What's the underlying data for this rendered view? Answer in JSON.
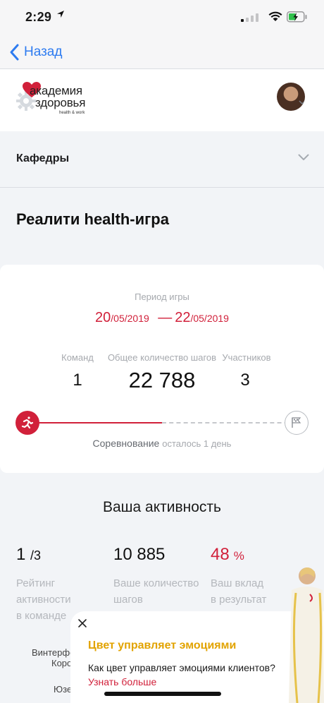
{
  "status_bar": {
    "time": "2:29"
  },
  "nav": {
    "back_label": "Назад"
  },
  "brand": {
    "line1": "академия",
    "line2": "здоровья",
    "tagline": "health & work"
  },
  "departments": {
    "label": "Кафедры"
  },
  "page_title": "Реалити health-игра",
  "game": {
    "period_label": "Период игры",
    "start_day_month": "20",
    "start_rest": "/05/2019",
    "end_day_month": "22",
    "end_rest": "/05/2019",
    "dash": "—",
    "teams_label": "Команд",
    "teams_value": "1",
    "steps_label": "Общее количество шагов",
    "steps_value": "22 788",
    "participants_label": "Участников",
    "participants_value": "3",
    "competition_label": "Соревнование",
    "remaining": "осталось 1 день",
    "progress_fraction": 0.5
  },
  "activity": {
    "title": "Ваша активность",
    "rating_value": "1",
    "rating_total": "/3",
    "rating_label": [
      "Рейтинг",
      "активности",
      "в команде"
    ],
    "steps_value": "10 885",
    "steps_label": [
      "Ваше количество",
      "шагов"
    ],
    "contribution_value": "48",
    "contribution_unit": "%",
    "contribution_label": [
      "Ваш вклад",
      "в результат"
    ]
  },
  "peek": {
    "line1": "Винтерфе",
    "line2": "Коро",
    "line3": "Юзе"
  },
  "promo": {
    "title": "Цвет управляет эмоциями",
    "text": "Как цвет управляет эмоциями клиентов?",
    "link": "Узнать больше"
  },
  "colors": {
    "accent": "#d1203a",
    "link": "#2d7bf0",
    "promo_title": "#e2a300"
  },
  "icons": [
    "location-arrow-icon",
    "signal-icon",
    "wifi-icon",
    "battery-charging-icon",
    "back-chevron-icon",
    "chevron-down-icon",
    "runner-icon",
    "finish-flag-icon",
    "close-icon"
  ]
}
